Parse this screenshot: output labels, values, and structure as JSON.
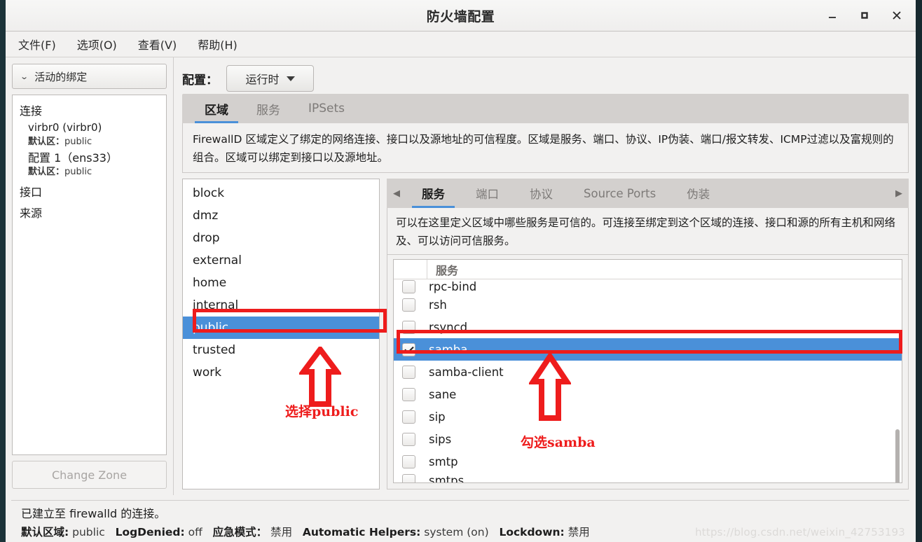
{
  "window": {
    "title": "防火墙配置",
    "minimize_label": "_",
    "maximize_label": "□",
    "close_label": "✕"
  },
  "menubar": {
    "items": [
      {
        "label": "文件(F)"
      },
      {
        "label": "选项(O)"
      },
      {
        "label": "查看(V)"
      },
      {
        "label": "帮助(H)"
      }
    ]
  },
  "sidebar": {
    "combo_label": "活动的绑定",
    "groups": [
      {
        "label": "连接"
      },
      {
        "label": "接口"
      },
      {
        "label": "来源"
      }
    ],
    "connections": [
      {
        "name": "virbr0 (virbr0)",
        "zone_key": "默认区：",
        "zone_value": "public"
      },
      {
        "name": "配置 1（ens33）",
        "zone_key": "默认区：",
        "zone_value": "public"
      }
    ],
    "change_zone_label": "Change Zone"
  },
  "toolbar": {
    "config_label": "配置：",
    "runtime_value": "运行时"
  },
  "outer_tabs": [
    {
      "label": "区域",
      "active": true
    },
    {
      "label": "服务",
      "active": false
    },
    {
      "label": "IPSets",
      "active": false
    }
  ],
  "outer_description": "FirewallD 区域定义了绑定的网络连接、接口以及源地址的可信程度。区域是服务、端口、协议、IP伪装、端口/报文转发、ICMP过滤以及富规则的组合。区域可以绑定到接口以及源地址。",
  "zones": [
    {
      "name": "block",
      "selected": false
    },
    {
      "name": "dmz",
      "selected": false
    },
    {
      "name": "drop",
      "selected": false
    },
    {
      "name": "external",
      "selected": false
    },
    {
      "name": "home",
      "selected": false
    },
    {
      "name": "internal",
      "selected": false
    },
    {
      "name": "public",
      "selected": true
    },
    {
      "name": "trusted",
      "selected": false
    },
    {
      "name": "work",
      "selected": false
    }
  ],
  "inner_tabs": {
    "prev_arrow": "◀",
    "next_arrow": "▶",
    "items": [
      {
        "label": "服务",
        "active": true
      },
      {
        "label": "端口",
        "active": false
      },
      {
        "label": "协议",
        "active": false
      },
      {
        "label": "Source Ports",
        "active": false
      },
      {
        "label": "伪装",
        "active": false
      }
    ]
  },
  "inner_description": "可以在这里定义区域中哪些服务是可信的。可连接至绑定到这个区域的连接、接口和源的所有主机和网络及、可以访问可信服务。",
  "services": {
    "column_header": "服务",
    "rows": [
      {
        "name": "rpc-bind",
        "checked": false,
        "selected": false,
        "clipped": "top"
      },
      {
        "name": "rsh",
        "checked": false,
        "selected": false
      },
      {
        "name": "rsyncd",
        "checked": false,
        "selected": false
      },
      {
        "name": "samba",
        "checked": true,
        "selected": true
      },
      {
        "name": "samba-client",
        "checked": false,
        "selected": false
      },
      {
        "name": "sane",
        "checked": false,
        "selected": false
      },
      {
        "name": "sip",
        "checked": false,
        "selected": false
      },
      {
        "name": "sips",
        "checked": false,
        "selected": false
      },
      {
        "name": "smtp",
        "checked": false,
        "selected": false
      },
      {
        "name": "smtps",
        "checked": false,
        "selected": false,
        "clipped": "bottom"
      }
    ]
  },
  "statusbar": {
    "connection_text": "已建立至 firewalld 的连接。",
    "default_zone_key": "默认区域:",
    "default_zone_value": "public",
    "logdenied_key": "LogDenied:",
    "logdenied_value": "off",
    "panic_key": "应急模式：",
    "panic_value": "禁用",
    "helpers_key": "Automatic Helpers:",
    "helpers_value": "system (on)",
    "lockdown_key": "Lockdown:",
    "lockdown_value": "禁用",
    "watermark": "https://blog.csdn.net/weixin_42753193"
  },
  "annotations": {
    "zone_note": "选择public",
    "service_note": "勾选samba",
    "accent_red": "#ee1c1c",
    "accent_blue": "#4a90d9"
  }
}
